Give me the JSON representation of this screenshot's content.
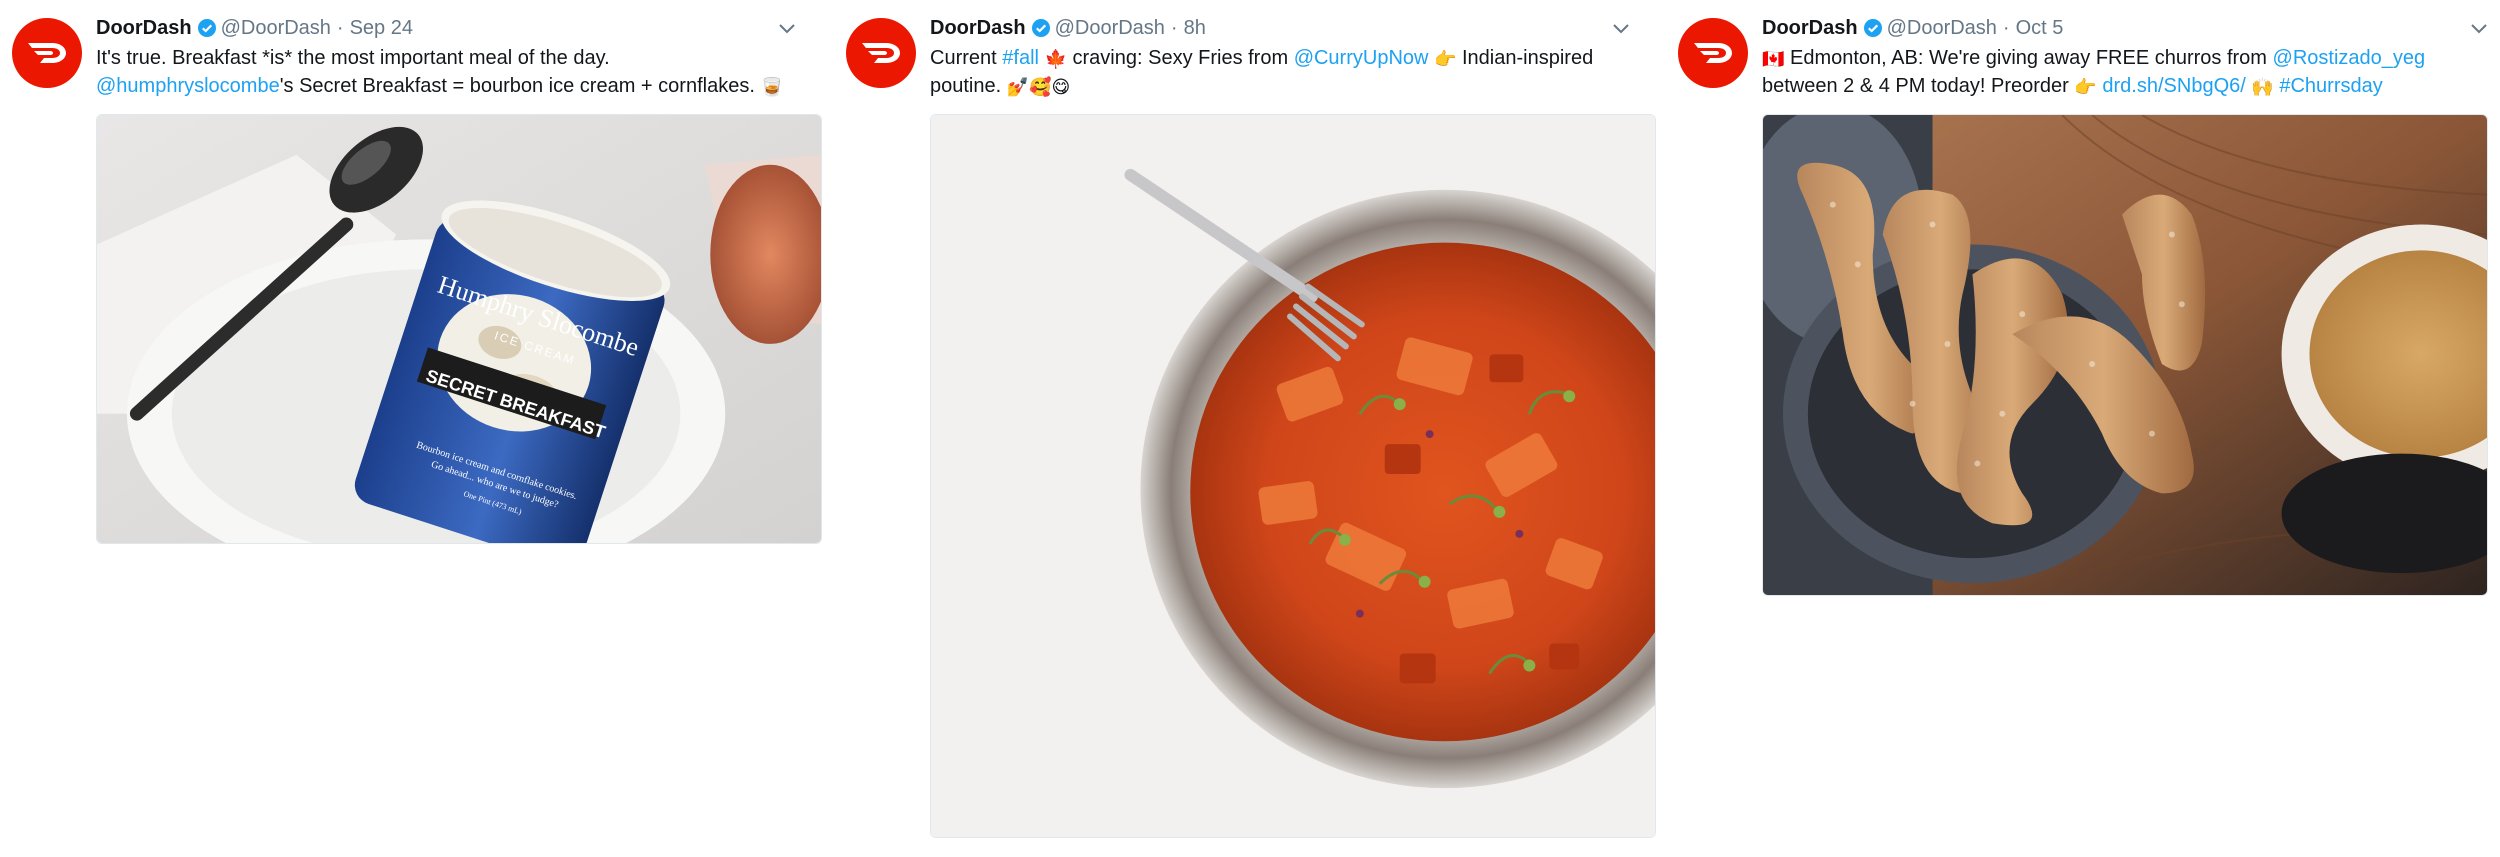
{
  "tweets": [
    {
      "name": "DoorDash",
      "handle": "@DoorDash",
      "separator": "·",
      "time": "Sep 24",
      "line1": "It's true. Breakfast *is* the most important meal of the day.",
      "mention": "@humphryslocombe",
      "line2_rest": "'s Secret Breakfast = bourbon ice cream + cornflakes.",
      "emoji_end": "🥃",
      "image": {
        "brand": "Humphry Slocombe",
        "subbrand": "ICE CREAM",
        "flavor": "SECRET BREAKFAST",
        "small_text_1": "Bourbon ice cream and cornflake cookies.",
        "small_text_2": "Go ahead... who are we to judge?",
        "small_text_3": "One Pint (473 mL)"
      }
    },
    {
      "name": "DoorDash",
      "handle": "@DoorDash",
      "separator": "·",
      "time": "8h",
      "word_current": "Current",
      "hashtag": "#fall",
      "emoji_leaf": "🍁",
      "craving": "craving: Sexy Fries from",
      "mention": "@CurryUpNow",
      "emoji_point": "👉",
      "indian": "Indian-inspired",
      "poutine": "poutine.",
      "emoji_end": "💅🥰😋"
    },
    {
      "name": "DoorDash",
      "handle": "@DoorDash",
      "separator": "·",
      "time": "Oct 5",
      "emoji_flag": "🇨🇦",
      "line1": "Edmonton, AB: We're giving away FREE churros from",
      "mention": "@Rostizado_yeg",
      "line2": "between 2 & 4 PM today! Preorder",
      "emoji_point": "👉",
      "link": "drd.sh/SNbgQ6/",
      "emoji_hands": "🙌",
      "hashtag": "#Churrsday"
    }
  ],
  "colors": {
    "brand_red": "#eb1700",
    "link_blue": "#1da1f2",
    "secondary_text": "#657786",
    "verified_blue": "#1da1f2"
  },
  "icons": [
    "doordash-logo-icon",
    "verified-badge-icon",
    "chevron-down-icon"
  ]
}
